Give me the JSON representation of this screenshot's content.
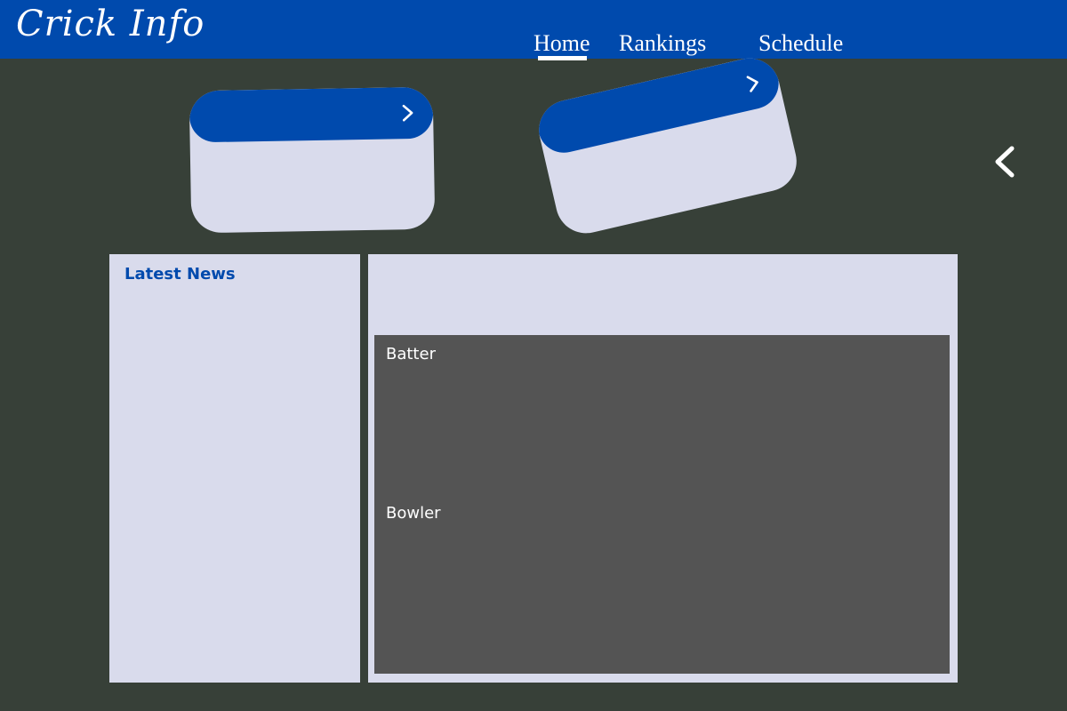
{
  "header": {
    "logo": "Crick Info",
    "nav": [
      {
        "label": "Home",
        "active": true
      },
      {
        "label": "Rankings",
        "active": false
      },
      {
        "label": "Schedule",
        "active": false
      }
    ]
  },
  "carousel": {
    "cards": [
      {
        "icon": "chevron-right-icon"
      },
      {
        "icon": "chevron-right-icon"
      }
    ],
    "prev_icon": "chevron-left-icon"
  },
  "news": {
    "title": "Latest News"
  },
  "stats": {
    "batter_label": "Batter",
    "bowler_label": "Bowler"
  },
  "colors": {
    "brand": "#004aad",
    "background": "#374038",
    "panel": "#d9dbec",
    "stats_box": "#545454",
    "text_light": "#ffffff"
  }
}
